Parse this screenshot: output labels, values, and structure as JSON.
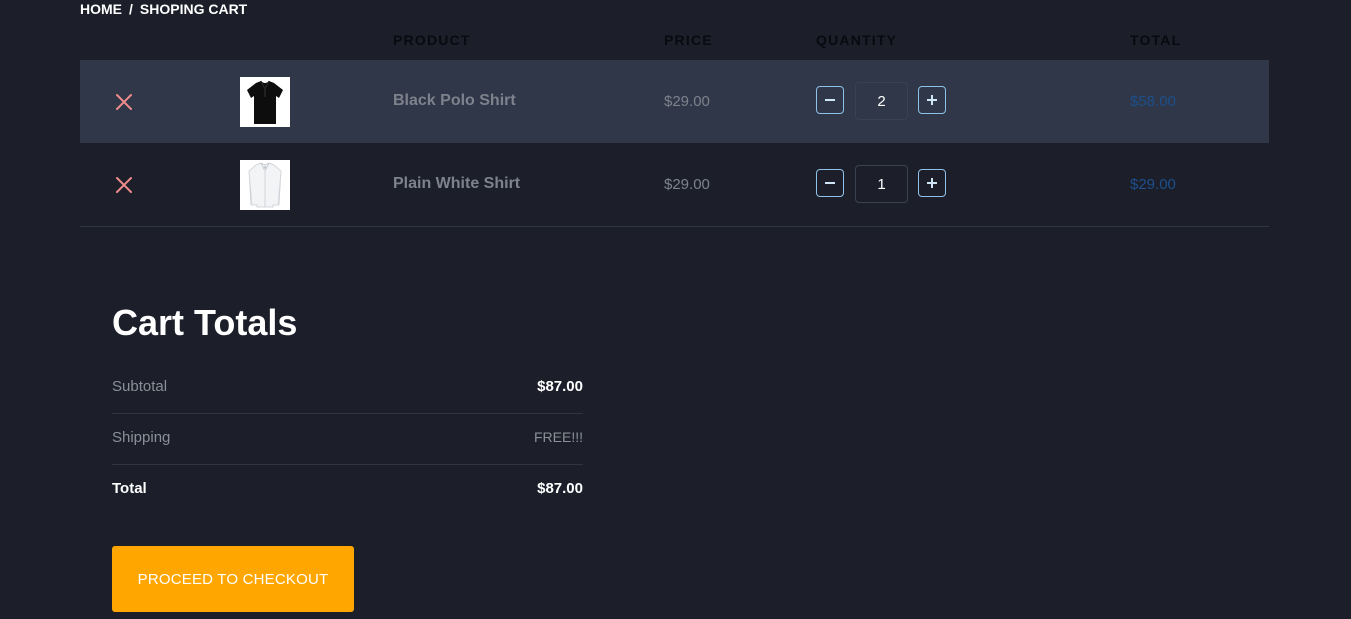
{
  "breadcrumb": {
    "home": "HOME",
    "separator": "/",
    "current": "SHOPING CART"
  },
  "table": {
    "headers": {
      "product": "PRODUCT",
      "price": "PRICE",
      "quantity": "QUANTITY",
      "total": "TOTAL"
    },
    "rows": [
      {
        "name": "Black Polo Shirt",
        "price": "$29.00",
        "quantity": "2",
        "total": "$58.00",
        "image": "black-polo-shirt"
      },
      {
        "name": "Plain White Shirt",
        "price": "$29.00",
        "quantity": "1",
        "total": "$29.00",
        "image": "plain-white-shirt"
      }
    ]
  },
  "cart_totals": {
    "title": "Cart Totals",
    "subtotal_label": "Subtotal",
    "subtotal_value": "$87.00",
    "shipping_label": "Shipping",
    "shipping_value": "FREE!!!",
    "total_label": "Total",
    "total_value": "$87.00"
  },
  "checkout_button": "PROCEED TO CHECKOUT",
  "colors": {
    "background": "#1c1f2a",
    "highlight_row": "#2f3748",
    "remove_icon": "#f08c8c",
    "accent_button": "#ffa700",
    "line_total": "#1d4f8c",
    "stepper_border": "#8fc2e8"
  }
}
